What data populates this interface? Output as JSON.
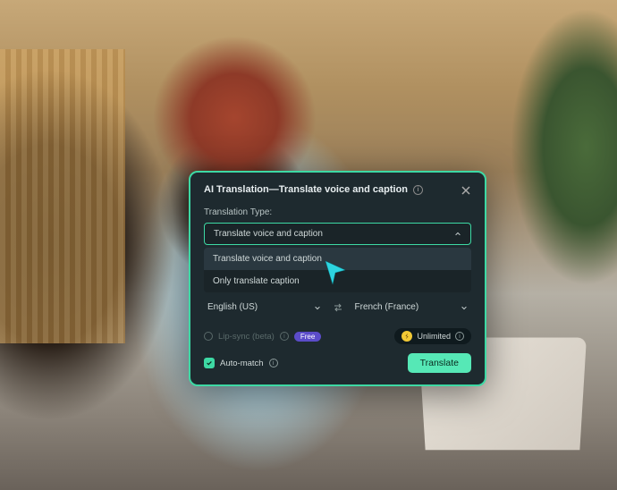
{
  "dialog": {
    "title": "AI Translation—Translate voice and caption",
    "type_label": "Translation Type:",
    "selected_type": "Translate voice and caption",
    "dropdown_options": {
      "opt1": "Translate voice and caption",
      "opt2": "Only translate caption"
    },
    "source_lang": "English (US)",
    "target_lang": "French (France)",
    "lip_sync_label": "Lip-sync (beta)",
    "free_badge": "Free",
    "unlimited_label": "Unlimited",
    "auto_match_label": "Auto-match",
    "translate_button": "Translate"
  }
}
